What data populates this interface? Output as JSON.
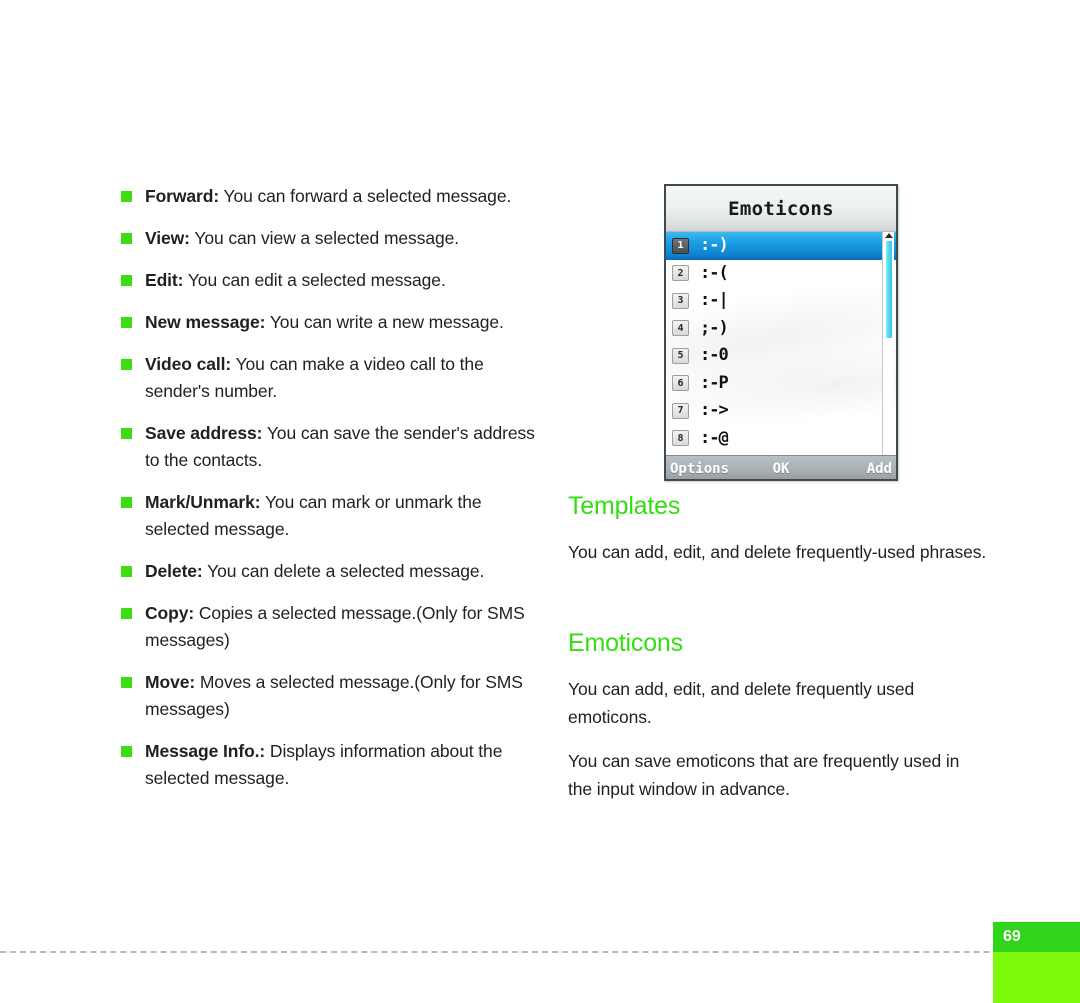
{
  "document": {
    "page_number": "69"
  },
  "left_column": {
    "items": [
      {
        "term": "Forward:",
        "description": "You can forward a selected message."
      },
      {
        "term": "View:",
        "description": "You can view a selected message."
      },
      {
        "term": "Edit:",
        "description": "You can edit a selected message."
      },
      {
        "term": "New message:",
        "description": "You can write a new message."
      },
      {
        "term": "Video call:",
        "description": "You can make a video call to the sender's number."
      },
      {
        "term": "Save address:",
        "description": "You can save the sender's address to the contacts."
      },
      {
        "term": "Mark/Unmark:",
        "description": "You can mark or unmark the selected message."
      },
      {
        "term": "Delete:",
        "description": "You can delete a selected message."
      },
      {
        "term": "Copy:",
        "description": "Copies a selected message.(Only for SMS messages)"
      },
      {
        "term": "Move:",
        "description": "Moves a selected message.(Only for SMS messages)"
      },
      {
        "term": "Message Info.:",
        "description": "Displays information about the selected message."
      }
    ]
  },
  "right_column": {
    "templates": {
      "heading": "Templates",
      "paragraph": "You can add, edit, and delete frequently-used phrases."
    },
    "emoticons": {
      "heading": "Emoticons",
      "paragraph_1": "You can add, edit, and delete frequently used emoticons.",
      "paragraph_2": "You can save emoticons that are frequently used in the input window in advance."
    }
  },
  "phone_screenshot": {
    "title": "Emoticons",
    "list": [
      {
        "index": "1",
        "emoticon": ":-)",
        "selected": true
      },
      {
        "index": "2",
        "emoticon": ":-(",
        "selected": false
      },
      {
        "index": "3",
        "emoticon": ":-|",
        "selected": false
      },
      {
        "index": "4",
        "emoticon": ";-)",
        "selected": false
      },
      {
        "index": "5",
        "emoticon": ":-0",
        "selected": false
      },
      {
        "index": "6",
        "emoticon": ":-P",
        "selected": false
      },
      {
        "index": "7",
        "emoticon": ":->",
        "selected": false
      },
      {
        "index": "8",
        "emoticon": ":-@",
        "selected": false
      }
    ],
    "softkeys": {
      "left": "Options",
      "center": "OK",
      "right": "Add"
    }
  },
  "colors": {
    "heading_green": "#33dd11",
    "bullet_green": "#3ddd13",
    "tab_green_top": "#2fd41b",
    "tab_green_bottom": "#7dfa0c",
    "selection_blue": "#1c9fe4",
    "scrollbar_cyan": "#4fd8ef"
  }
}
